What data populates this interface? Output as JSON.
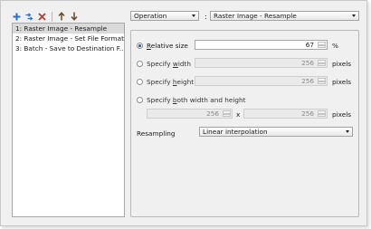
{
  "toolbar": {
    "buttons": [
      {
        "name": "add",
        "icon": "plus-icon"
      },
      {
        "name": "duplicate",
        "icon": "duplicate-icon"
      },
      {
        "name": "delete",
        "icon": "delete-icon"
      },
      {
        "name": "move-up",
        "icon": "arrow-up-icon"
      },
      {
        "name": "move-down",
        "icon": "arrow-down-icon"
      }
    ]
  },
  "steps": [
    "1: Raster Image - Resample",
    "2: Raster Image - Set File Format",
    "3: Batch - Save to Destination F..."
  ],
  "selected_step": 0,
  "operation_dropdown": "Operation",
  "colon": ":",
  "operation_value": "Raster Image - Resample",
  "options": {
    "relative_size": {
      "label": "Relative size",
      "value": "67",
      "unit": "%"
    },
    "specify_width": {
      "label": "Specify width",
      "value": "256",
      "unit": "pixels"
    },
    "specify_height": {
      "label": "Specify height",
      "value": "256",
      "unit": "pixels"
    },
    "specify_both": {
      "label": "Specify both width and height",
      "width": "256",
      "x": "x",
      "height": "256",
      "unit": "pixels"
    }
  },
  "resampling": {
    "label": "Resampling",
    "value": "Linear interpolation"
  },
  "colors": {
    "selected_radio": "#2c5fb0",
    "plus_icon": "#2c6ecb",
    "delete_icon": "#c0392b"
  }
}
